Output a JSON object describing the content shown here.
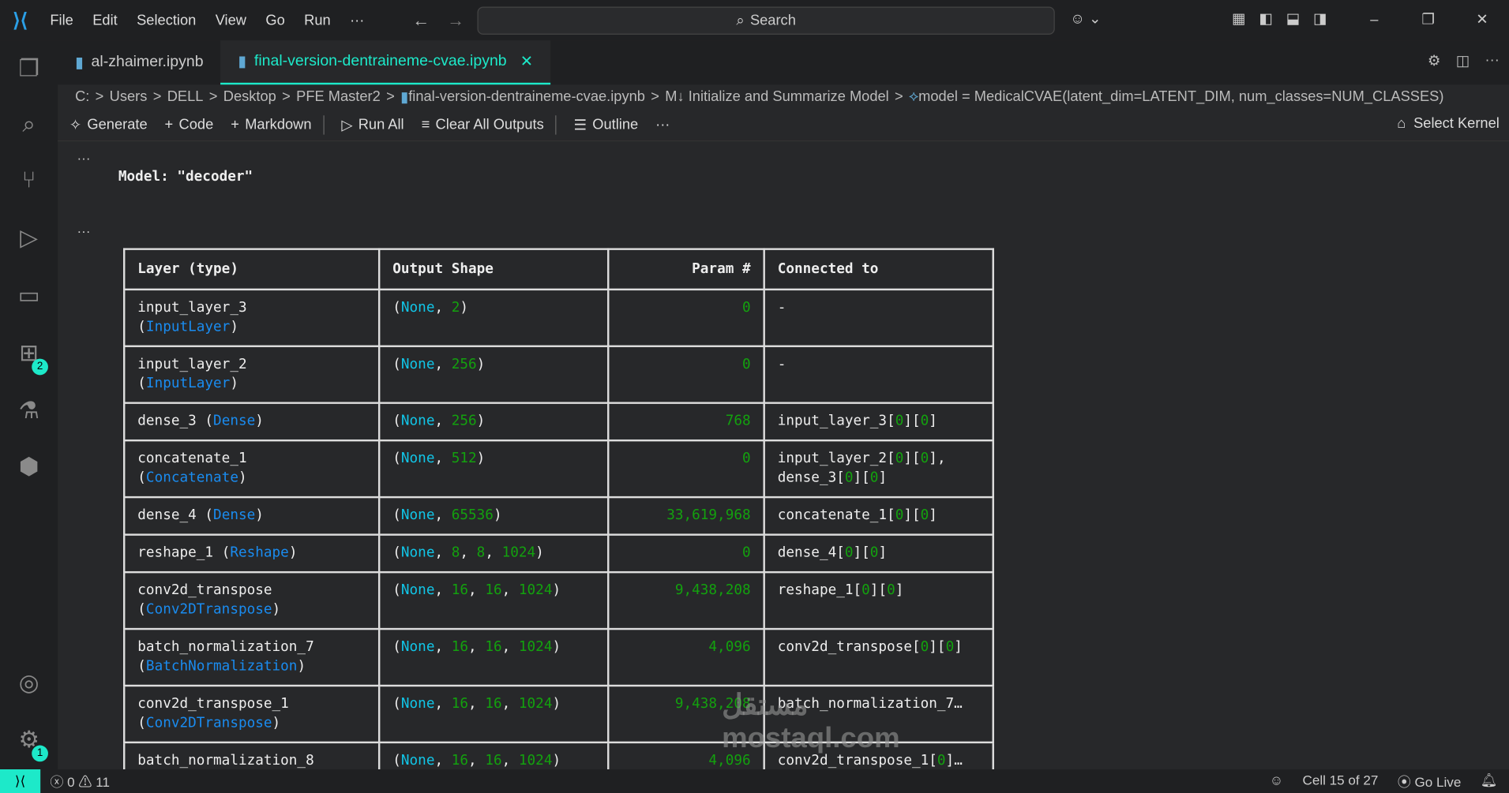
{
  "titlebar": {
    "menu": [
      "File",
      "Edit",
      "Selection",
      "View",
      "Go",
      "Run",
      "···"
    ],
    "search": "Search"
  },
  "activity_badges": {
    "extensions": "2",
    "settings": "1"
  },
  "tabs": [
    {
      "label": "al-zhaimer.ipynb",
      "active": false
    },
    {
      "label": "final-version-dentraineme-cvae.ipynb",
      "active": true
    }
  ],
  "breadcrumb": [
    "C:",
    "Users",
    "DELL",
    "Desktop",
    "PFE Master2",
    "final-version-dentraineme-cvae.ipynb",
    "M↓ Initialize and Summarize Model",
    "model = MedicalCVAE(latent_dim=LATENT_DIM, num_classes=NUM_CLASSES)"
  ],
  "toolbar": {
    "generate": "Generate",
    "code": "Code",
    "markdown": "Markdown",
    "run_all": "Run All",
    "clear": "Clear All Outputs",
    "outline": "Outline",
    "more": "···",
    "kernel": "Select Kernel"
  },
  "output": {
    "ellipsis": "···",
    "model_title": "Model: \"decoder\"",
    "headers": [
      "Layer (type)",
      "Output Shape",
      "Param #",
      "Connected to"
    ],
    "rows": [
      {
        "layer": "input_layer_3",
        "type": "InputLayer",
        "shape": "(None, 2)",
        "params": "0",
        "connected": "-"
      },
      {
        "layer": "input_layer_2",
        "type": "InputLayer",
        "shape": "(None, 256)",
        "params": "0",
        "connected": "-"
      },
      {
        "layer": "dense_3",
        "type": "Dense",
        "inline": true,
        "shape": "(None, 256)",
        "params": "768",
        "connected": "input_layer_3[0][0]"
      },
      {
        "layer": "concatenate_1",
        "type": "Concatenate",
        "shape": "(None, 512)",
        "params": "0",
        "connected": "input_layer_2[0][0],\ndense_3[0][0]"
      },
      {
        "layer": "dense_4",
        "type": "Dense",
        "inline": true,
        "shape": "(None, 65536)",
        "params": "33,619,968",
        "connected": "concatenate_1[0][0]"
      },
      {
        "layer": "reshape_1",
        "type": "Reshape",
        "inline": true,
        "shape": "(None, 8, 8, 1024)",
        "params": "0",
        "connected": "dense_4[0][0]"
      },
      {
        "layer": "conv2d_transpose",
        "type": "Conv2DTranspose",
        "shape": "(None, 16, 16, 1024)",
        "params": "9,438,208",
        "connected": "reshape_1[0][0]"
      },
      {
        "layer": "batch_normalization_7",
        "type": "BatchNormalization",
        "shape": "(None, 16, 16, 1024)",
        "params": "4,096",
        "connected": "conv2d_transpose[0][0]"
      },
      {
        "layer": "conv2d_transpose_1",
        "type": "Conv2DTranspose",
        "shape": "(None, 16, 16, 1024)",
        "params": "9,438,208",
        "connected": "batch_normalization_7…"
      },
      {
        "layer": "batch_normalization_8",
        "type": "",
        "shape": "(None, 16, 16, 1024)",
        "params": "4,096",
        "connected": "conv2d_transpose_1[0]…"
      }
    ]
  },
  "statusbar": {
    "errors": "0",
    "warnings": "11",
    "cell": "Cell 15 of 27",
    "golive": "Go Live"
  },
  "watermark": "mostaql.com"
}
